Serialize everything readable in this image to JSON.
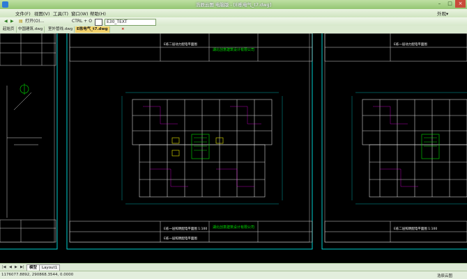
{
  "window": {
    "title": "浩辰云图 电脑版 - [E栋电气_t7.dwg]",
    "min_glyph": "–",
    "max_glyph": "□",
    "close_glyph": "×"
  },
  "menu": {
    "items": [
      "文件(F)",
      "视图(V)",
      "工具(T)",
      "窗口(W)",
      "帮助(H)"
    ],
    "right_label": "外观▾"
  },
  "toolbar": {
    "open_label": "打开(O)...",
    "command_hint": "CTRL + O",
    "layer_value": "E30_TEXT"
  },
  "file_tabs": [
    {
      "label": "起始页"
    },
    {
      "label": "中国建筑.dwg"
    },
    {
      "label": "室外管线.dwg"
    },
    {
      "label": "E栋电气_t7.dwg"
    }
  ],
  "drawing": {
    "title_blocks": [
      {
        "company": "湖北创意建筑设计有限公司",
        "sheet": "E栋二层动力配电平面图  1:100"
      },
      {
        "company": "湖北创意建筑设计有限公司",
        "sheet": "E栋一层照明配电平面图  1:100"
      },
      {
        "sheet": "E栋二层动力配电平面图"
      },
      {
        "sheet": "E栋二层照明配电平面图  1:100"
      },
      {
        "sheet": "E栋一层动力配电平面图"
      },
      {
        "sheet": "E栋一层照明配电平面图"
      }
    ]
  },
  "layout_tabs": [
    "模型",
    "Layout1"
  ],
  "layout_nav": [
    "|◀",
    "◀",
    "▶",
    "▶|"
  ],
  "status": {
    "coordinates": "1176077.8892, 290868.3544, 0.0000",
    "app": "浩辰云图"
  },
  "colors": {
    "frame": "#00d0d0",
    "cad_line": "#d8d8d8",
    "green": "#00e000",
    "yellow": "#e8e800",
    "magenta": "#e000e0"
  }
}
